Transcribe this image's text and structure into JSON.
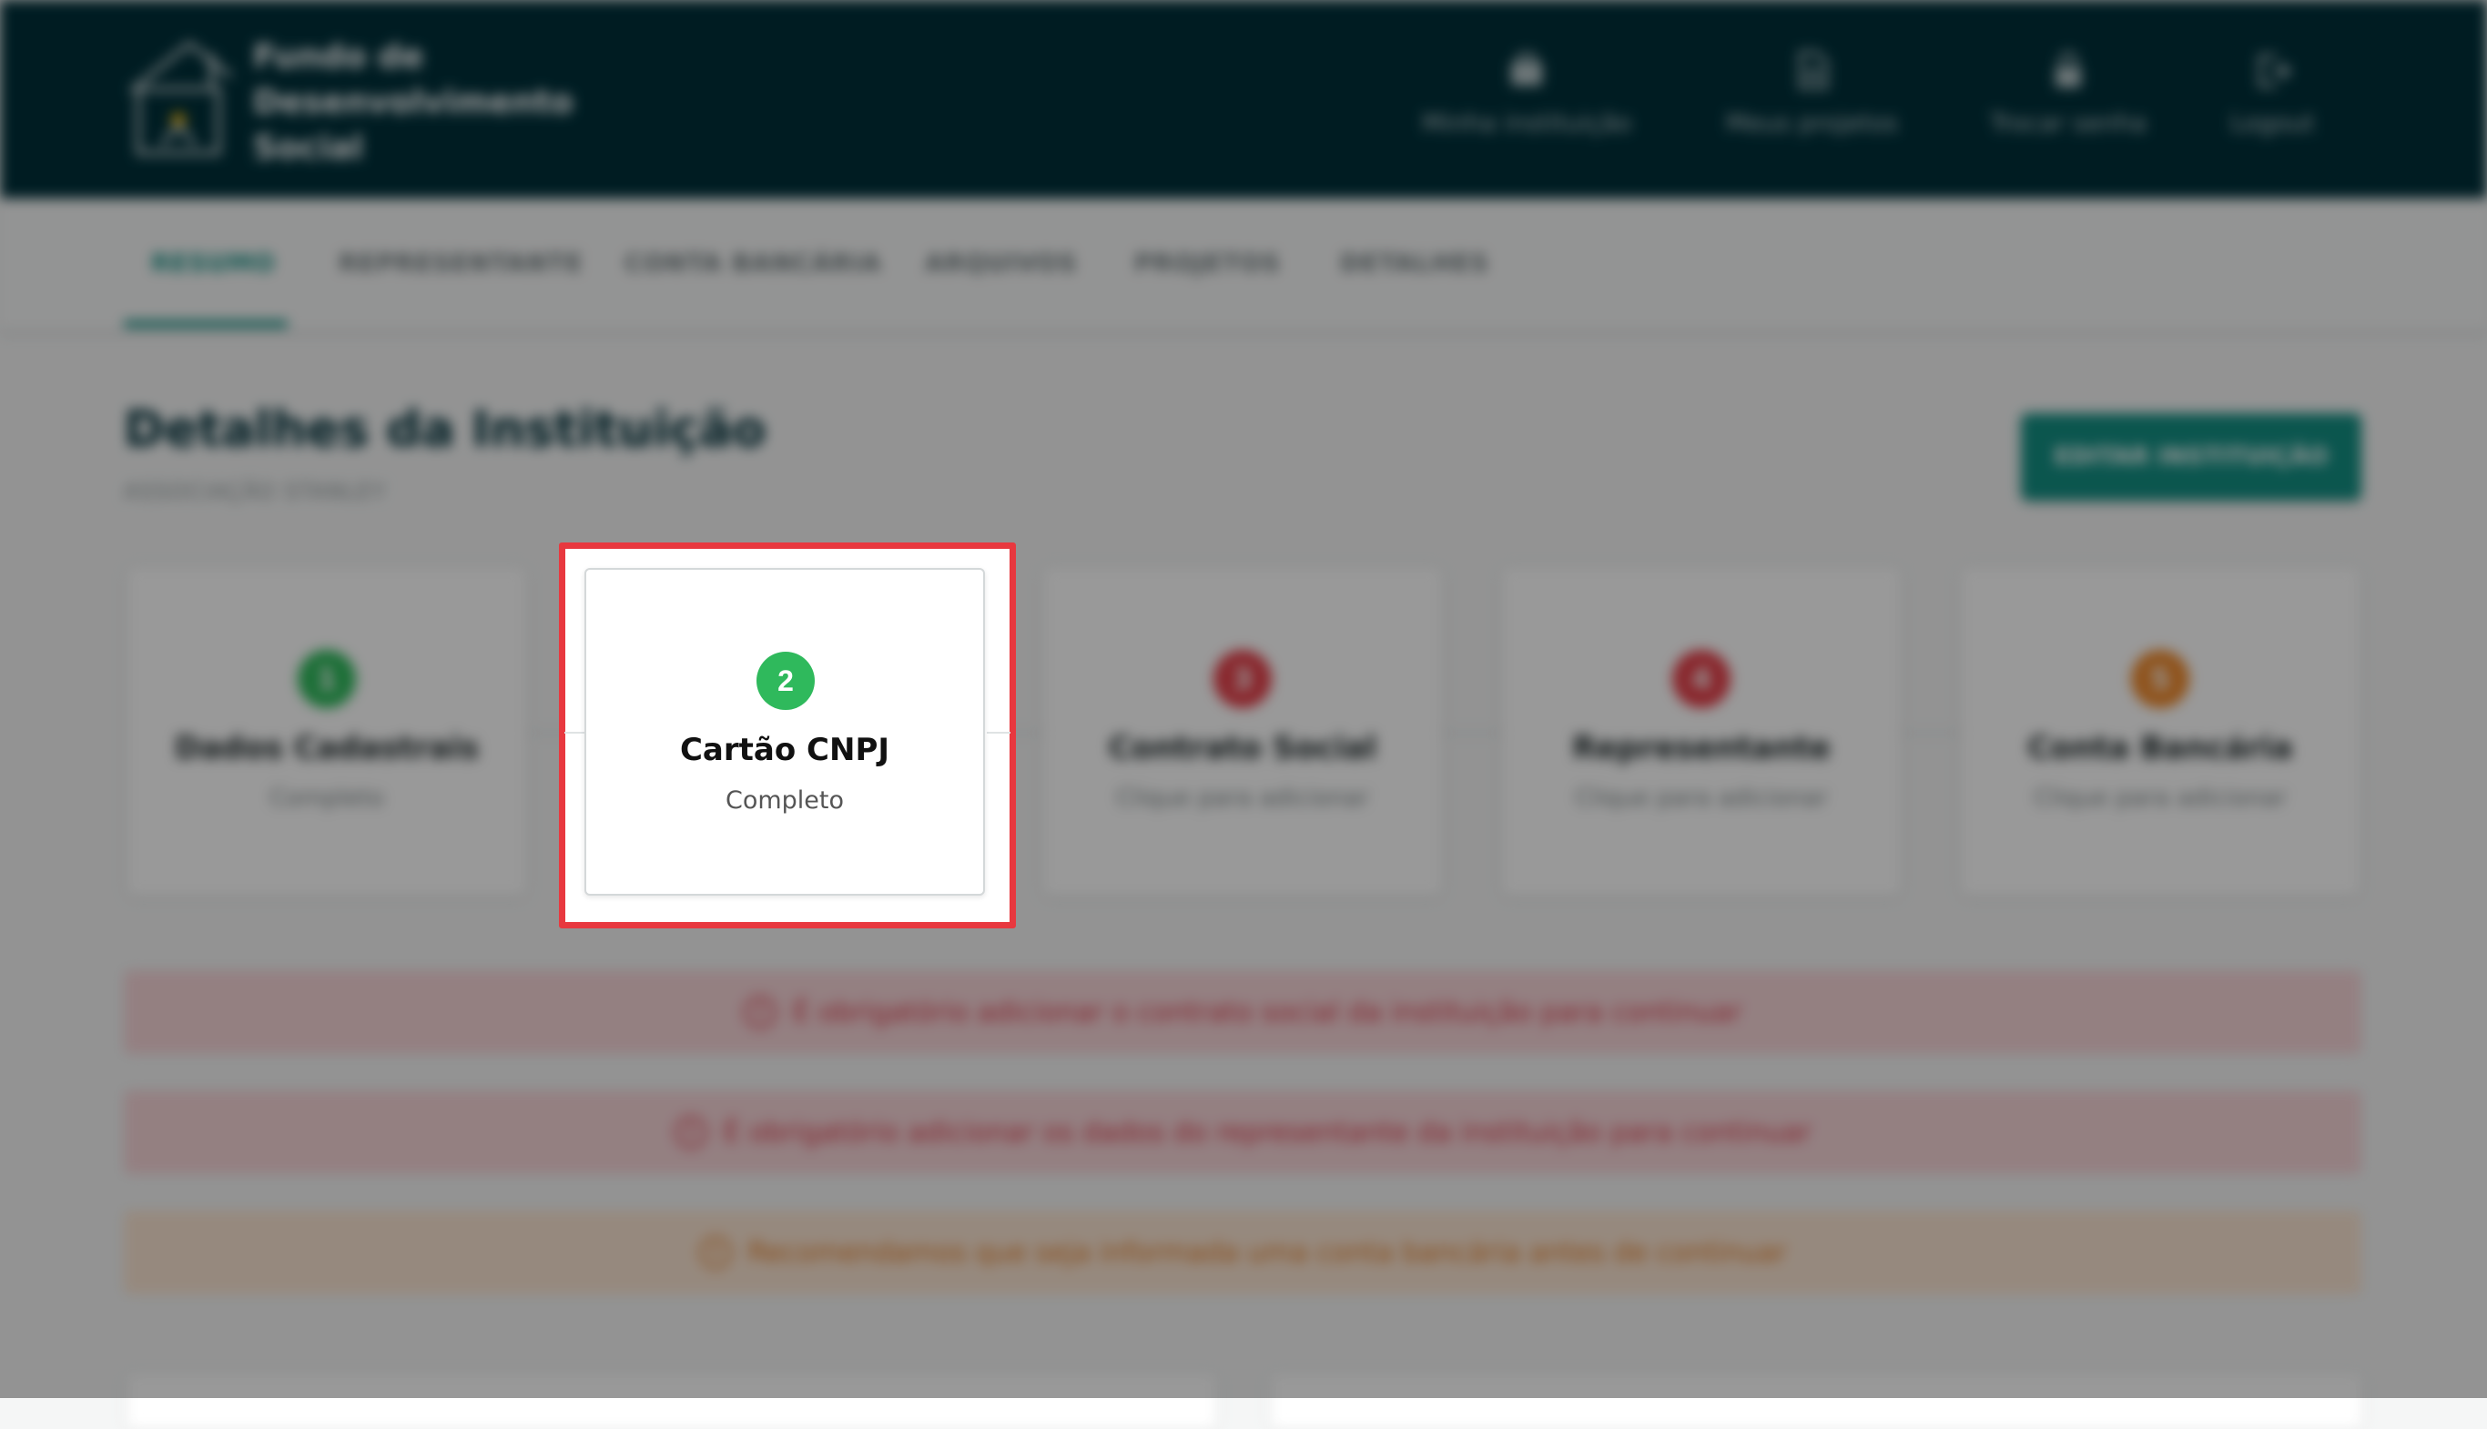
{
  "header": {
    "brand_lines": [
      "Fundo de",
      "Desenvolvimento",
      "Social"
    ],
    "logo_icon": "house-flag-logo",
    "nav": [
      {
        "label": "Minha instituição",
        "icon": "bank-icon"
      },
      {
        "label": "Meus projetos",
        "icon": "document-icon"
      },
      {
        "label": "Trocar senha",
        "icon": "lock-icon"
      },
      {
        "label": "Logout",
        "icon": "logout-icon"
      }
    ],
    "background_color": "#00303a"
  },
  "tabs": [
    {
      "label": "RESUMO",
      "active": true
    },
    {
      "label": "REPRESENTANTE",
      "active": false
    },
    {
      "label": "CONTA BANCÁRIA",
      "active": false
    },
    {
      "label": "ARQUIVOS",
      "active": false
    },
    {
      "label": "PROJETOS",
      "active": false
    },
    {
      "label": "DETALHES",
      "active": false
    }
  ],
  "page": {
    "title": "Detalhes da Instituição",
    "subtitle": "ASSOCIAÇÃO STANLEY",
    "edit_button": "EDITAR INSTITUIÇÃO"
  },
  "steps": [
    {
      "number": "1",
      "title": "Dados Cadastrais",
      "status": "Completo",
      "color": "#2fb95c"
    },
    {
      "number": "2",
      "title": "Cartão CNPJ",
      "status": "Completo",
      "color": "#2fb95c"
    },
    {
      "number": "3",
      "title": "Contrato Social",
      "status": "Clique para adicionar",
      "color": "#e5414b"
    },
    {
      "number": "4",
      "title": "Representante",
      "status": "Clique para adicionar",
      "color": "#e5414b"
    },
    {
      "number": "5",
      "title": "Conta Bancária",
      "status": "Clique para adicionar",
      "color": "#ef8a2e"
    }
  ],
  "alerts": [
    {
      "type": "error",
      "text": "É obrigatório adicionar o contrato social da instituição para continuar",
      "icon": "error-icon"
    },
    {
      "type": "error",
      "text": "É obrigatório adicionar os dados do representante da instituição para continuar",
      "icon": "error-icon"
    },
    {
      "type": "warn",
      "text": "Recomendamos que seja informada uma conta bancária antes de continuar",
      "icon": "warning-icon"
    }
  ],
  "highlight": {
    "step_index": 1,
    "border_color": "#e8383f"
  },
  "colors": {
    "accent": "#138f83",
    "success": "#2fb95c",
    "error": "#e5414b",
    "warning": "#ef8a2e"
  }
}
